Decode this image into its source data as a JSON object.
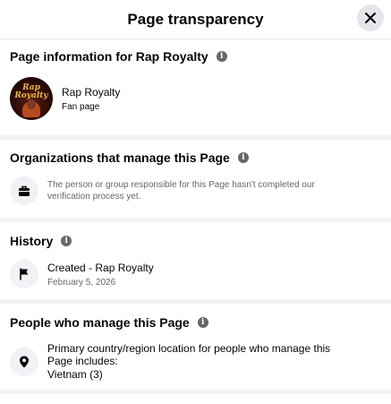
{
  "header": {
    "title": "Page transparency",
    "close_icon": "close-icon"
  },
  "page_info": {
    "title": "Page information for Rap Royalty",
    "page_name": "Rap Royalty",
    "page_category": "Fan page",
    "avatar_logo_text": "Rap Royalty"
  },
  "organizations": {
    "title": "Organizations that manage this Page",
    "icon": "briefcase-icon",
    "description": "The person or group responsible for this Page hasn't completed our verification process yet."
  },
  "history": {
    "title": "History",
    "icon": "flag-icon",
    "event": "Created - Rap Royalty",
    "date": "February 5, 2026"
  },
  "managers": {
    "title": "People who manage this Page",
    "icon": "location-pin-icon",
    "description": "Primary country/region location for people who manage this Page includes:",
    "location": "Vietnam (3)"
  },
  "colors": {
    "section_divider": "#f0f2f5",
    "secondary_text": "#65676b",
    "close_button_bg": "#e4e6eb"
  }
}
